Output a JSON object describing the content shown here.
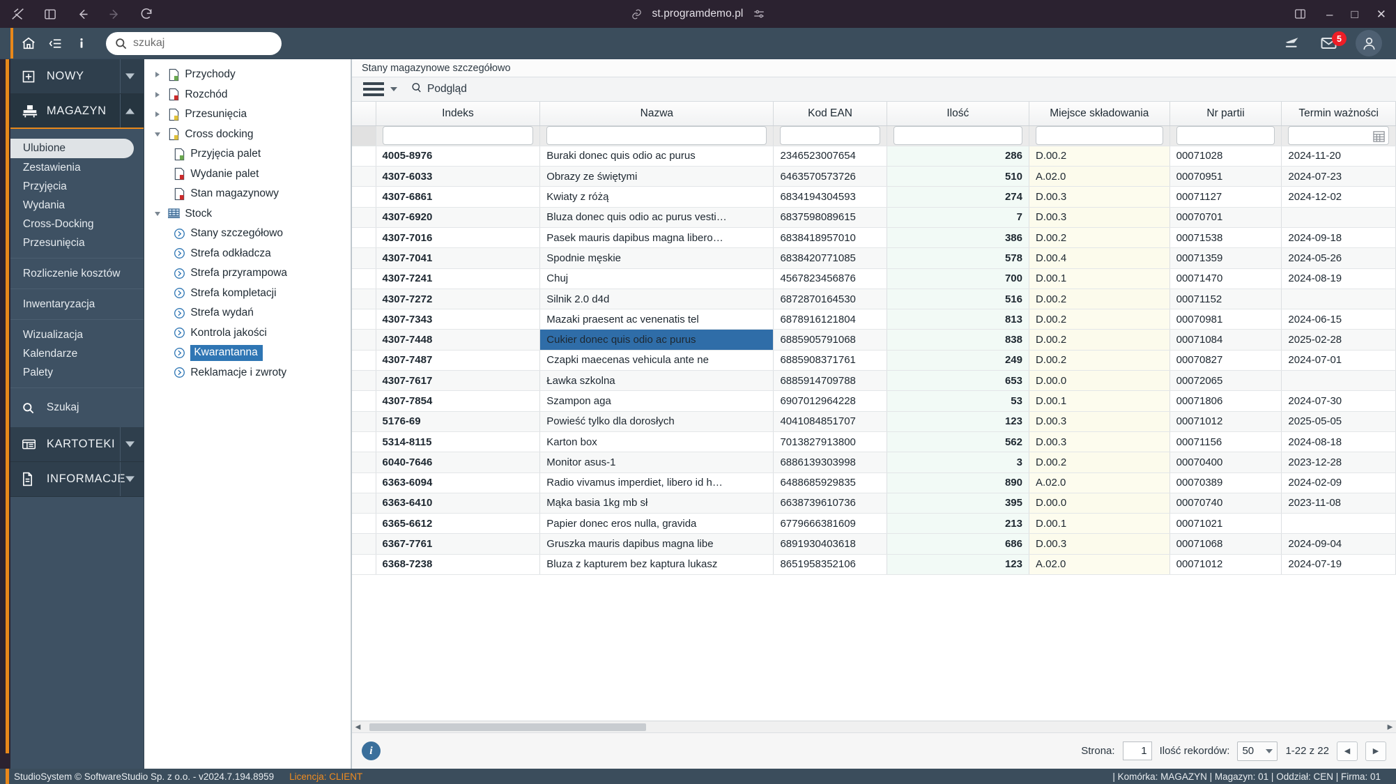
{
  "browser": {
    "url": "st.programdemo.pl",
    "icons": [
      "app-logo-icon",
      "sidebar-toggle-icon",
      "back-icon",
      "forward-icon",
      "reload-icon",
      "link-icon",
      "tune-icon",
      "split-view-icon",
      "minimize-icon",
      "maximize-icon",
      "close-icon"
    ]
  },
  "topbar": {
    "search_placeholder": "szukaj",
    "search_value": "",
    "mail_badge": "5",
    "icons": [
      "home-icon",
      "menu-collapse-icon",
      "info-icon",
      "search-icon",
      "send-icon",
      "mail-icon",
      "user-avatar-icon"
    ]
  },
  "sidebar": {
    "groups": [
      {
        "label": "NOWY",
        "icon": "plus-box-icon",
        "caret": "down",
        "active": false
      },
      {
        "label": "MAGAZYN",
        "icon": "warehouse-icon",
        "caret": "up",
        "active": true
      }
    ],
    "items": [
      {
        "label": "Ulubione",
        "selected": true
      },
      {
        "label": "Zestawienia",
        "selected": false
      },
      {
        "label": "Przyjęcia",
        "selected": false
      },
      {
        "label": "Wydania",
        "selected": false
      },
      {
        "label": "Cross-Docking",
        "selected": false
      },
      {
        "label": "Przesunięcia",
        "selected": false
      },
      {
        "label": "Rozliczenie kosztów",
        "selected": false,
        "sep_before": true
      },
      {
        "label": "Inwentaryzacja",
        "selected": false,
        "sep_before": true
      },
      {
        "label": "Wizualizacja",
        "selected": false,
        "sep_before": true
      },
      {
        "label": "Kalendarze",
        "selected": false
      },
      {
        "label": "Palety",
        "selected": false
      },
      {
        "label": "Szukaj",
        "selected": false,
        "icon": "search-icon",
        "sep_before": true
      }
    ],
    "bottom_groups": [
      {
        "label": "KARTOTEKI",
        "icon": "cards-icon",
        "caret": "down"
      },
      {
        "label": "INFORMACJE",
        "icon": "document-icon",
        "caret": "down"
      }
    ]
  },
  "tree": [
    {
      "label": "Przychody",
      "level": 0,
      "toggle": "collapsed",
      "icon": "doc-green-icon"
    },
    {
      "label": "Rozchód",
      "level": 0,
      "toggle": "collapsed",
      "icon": "doc-red-icon"
    },
    {
      "label": "Przesunięcia",
      "level": 0,
      "toggle": "collapsed",
      "icon": "doc-yellow-icon"
    },
    {
      "label": "Cross docking",
      "level": 0,
      "toggle": "expanded",
      "icon": "doc-yellow-icon"
    },
    {
      "label": "Przyjęcia palet",
      "level": 1,
      "toggle": "none",
      "icon": "doc-green-icon"
    },
    {
      "label": "Wydanie palet",
      "level": 1,
      "toggle": "none",
      "icon": "doc-red-icon"
    },
    {
      "label": "Stan magazynowy",
      "level": 1,
      "toggle": "none",
      "icon": "doc-red-icon"
    },
    {
      "label": "Stock",
      "level": 0,
      "toggle": "expanded",
      "icon": "grid-blue-icon"
    },
    {
      "label": "Stany szczegółowo",
      "level": 1,
      "toggle": "none",
      "icon": "arrow-circle-icon"
    },
    {
      "label": "Strefa odkładcza",
      "level": 1,
      "toggle": "none",
      "icon": "arrow-circle-icon"
    },
    {
      "label": "Strefa przyrampowa",
      "level": 1,
      "toggle": "none",
      "icon": "arrow-circle-icon"
    },
    {
      "label": "Strefa kompletacji",
      "level": 1,
      "toggle": "none",
      "icon": "arrow-circle-icon"
    },
    {
      "label": "Strefa wydań",
      "level": 1,
      "toggle": "none",
      "icon": "arrow-circle-icon"
    },
    {
      "label": "Kontrola jakości",
      "level": 1,
      "toggle": "none",
      "icon": "arrow-circle-icon"
    },
    {
      "label": "Kwarantanna",
      "level": 1,
      "toggle": "none",
      "icon": "arrow-circle-icon",
      "selected": true
    },
    {
      "label": "Reklamacje i zwroty",
      "level": 1,
      "toggle": "none",
      "icon": "arrow-circle-icon"
    }
  ],
  "main": {
    "title": "Stany magazynowe szczegółowo",
    "toolbar": {
      "preview_label": "Podgląd",
      "menu_icon": "hamburger-icon",
      "preview_icon": "search-icon"
    },
    "columns": [
      "Indeks",
      "Nazwa",
      "Kod EAN",
      "Ilość",
      "Miejsce składowania",
      "Nr partii",
      "Termin ważności"
    ],
    "filters": [
      "",
      "",
      "",
      "",
      "",
      "",
      ""
    ],
    "selected_cell": {
      "row": 9,
      "column": "Nazwa"
    },
    "rows": [
      {
        "indeks": "4005-8976",
        "nazwa": "Buraki donec quis odio ac purus",
        "ean": "2346523007654",
        "ilosc": "286",
        "miejsce": "D.00.2",
        "partia": "00071028",
        "termin": "2024-11-20"
      },
      {
        "indeks": "4307-6033",
        "nazwa": "Obrazy ze świętymi",
        "ean": "6463570573726",
        "ilosc": "510",
        "miejsce": "A.02.0",
        "partia": "00070951",
        "termin": "2024-07-23"
      },
      {
        "indeks": "4307-6861",
        "nazwa": "Kwiaty z różą",
        "ean": "6834194304593",
        "ilosc": "274",
        "miejsce": "D.00.3",
        "partia": "00071127",
        "termin": "2024-12-02"
      },
      {
        "indeks": "4307-6920",
        "nazwa": "Bluza donec quis odio ac purus vesti…",
        "ean": "6837598089615",
        "ilosc": "7",
        "miejsce": "D.00.3",
        "partia": "00070701",
        "termin": ""
      },
      {
        "indeks": "4307-7016",
        "nazwa": "Pasek mauris dapibus magna libero…",
        "ean": "6838418957010",
        "ilosc": "386",
        "miejsce": "D.00.2",
        "partia": "00071538",
        "termin": "2024-09-18"
      },
      {
        "indeks": "4307-7041",
        "nazwa": "Spodnie męskie",
        "ean": "6838420771085",
        "ilosc": "578",
        "miejsce": "D.00.4",
        "partia": "00071359",
        "termin": "2024-05-26"
      },
      {
        "indeks": "4307-7241",
        "nazwa": "Chuj",
        "ean": "4567823456876",
        "ilosc": "700",
        "miejsce": "D.00.1",
        "partia": "00071470",
        "termin": "2024-08-19"
      },
      {
        "indeks": "4307-7272",
        "nazwa": "Silnik 2.0 d4d",
        "ean": "6872870164530",
        "ilosc": "516",
        "miejsce": "D.00.2",
        "partia": "00071152",
        "termin": ""
      },
      {
        "indeks": "4307-7343",
        "nazwa": "Mazaki praesent ac venenatis tel",
        "ean": "6878916121804",
        "ilosc": "813",
        "miejsce": "D.00.2",
        "partia": "00070981",
        "termin": "2024-06-15"
      },
      {
        "indeks": "4307-7448",
        "nazwa": "Cukier donec quis odio ac purus",
        "ean": "6885905791068",
        "ilosc": "838",
        "miejsce": "D.00.2",
        "partia": "00071084",
        "termin": "2025-02-28"
      },
      {
        "indeks": "4307-7487",
        "nazwa": "Czapki maecenas vehicula ante ne",
        "ean": "6885908371761",
        "ilosc": "249",
        "miejsce": "D.00.2",
        "partia": "00070827",
        "termin": "2024-07-01"
      },
      {
        "indeks": "4307-7617",
        "nazwa": "Ławka szkolna",
        "ean": "6885914709788",
        "ilosc": "653",
        "miejsce": "D.00.0",
        "partia": "00072065",
        "termin": ""
      },
      {
        "indeks": "4307-7854",
        "nazwa": "Szampon aga",
        "ean": "6907012964228",
        "ilosc": "53",
        "miejsce": "D.00.1",
        "partia": "00071806",
        "termin": "2024-07-30"
      },
      {
        "indeks": "5176-69",
        "nazwa": "Powieść tylko dla dorosłych",
        "ean": "4041084851707",
        "ilosc": "123",
        "miejsce": "D.00.3",
        "partia": "00071012",
        "termin": "2025-05-05"
      },
      {
        "indeks": "5314-8115",
        "nazwa": "Karton box",
        "ean": "7013827913800",
        "ilosc": "562",
        "miejsce": "D.00.3",
        "partia": "00071156",
        "termin": "2024-08-18"
      },
      {
        "indeks": "6040-7646",
        "nazwa": "Monitor asus-1",
        "ean": "6886139303998",
        "ilosc": "3",
        "miejsce": "D.00.2",
        "partia": "00070400",
        "termin": "2023-12-28"
      },
      {
        "indeks": "6363-6094",
        "nazwa": "Radio vivamus imperdiet, libero id h…",
        "ean": "6488685929835",
        "ilosc": "890",
        "miejsce": "A.02.0",
        "partia": "00070389",
        "termin": "2024-02-09"
      },
      {
        "indeks": "6363-6410",
        "nazwa": "Mąka basia 1kg mb sł",
        "ean": "6638739610736",
        "ilosc": "395",
        "miejsce": "D.00.0",
        "partia": "00070740",
        "termin": "2023-11-08"
      },
      {
        "indeks": "6365-6612",
        "nazwa": "Papier donec eros nulla, gravida",
        "ean": "6779666381609",
        "ilosc": "213",
        "miejsce": "D.00.1",
        "partia": "00071021",
        "termin": ""
      },
      {
        "indeks": "6367-7761",
        "nazwa": "Gruszka mauris dapibus magna libe",
        "ean": "6891930403618",
        "ilosc": "686",
        "miejsce": "D.00.3",
        "partia": "00071068",
        "termin": "2024-09-04"
      },
      {
        "indeks": "6368-7238",
        "nazwa": "Bluza z kapturem bez kaptura lukasz",
        "ean": "8651958352106",
        "ilosc": "123",
        "miejsce": "A.02.0",
        "partia": "00071012",
        "termin": "2024-07-19"
      }
    ],
    "footer": {
      "info_icon": "info-icon",
      "page_label": "Strona:",
      "page_value": "1",
      "records_label": "Ilość rekordów:",
      "records_value": "50",
      "range_text": "1-22 z 22",
      "prev_icon": "prev-page-icon",
      "next_icon": "next-page-icon"
    }
  },
  "statusbar": {
    "left": "StudioSystem © SoftwareStudio Sp. z o.o. - v2024.7.194.8959",
    "license": "Licencja: CLIENT",
    "right": "| Komórka: MAGAZYN | Magazyn: 01 | Oddział: CEN | Firma: 01"
  },
  "colors": {
    "accent_orange": "#e8881a",
    "sidebar_bg": "#3e5163",
    "selection_blue": "#2f6da8",
    "badge_red": "#ee1d26"
  }
}
